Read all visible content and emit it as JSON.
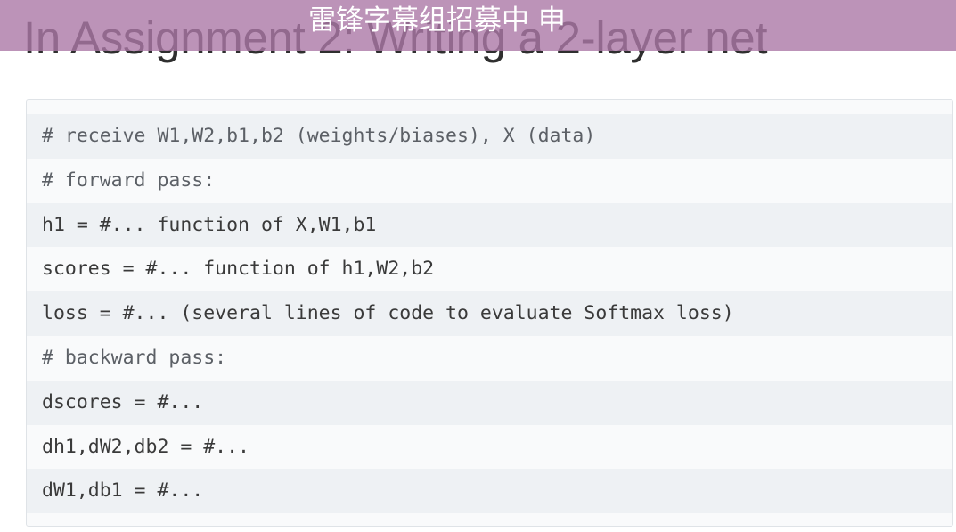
{
  "slide": {
    "title": "In Assignment 2: Writing a 2-layer net"
  },
  "subtitle_banner": {
    "text": "雷锋字幕组招募中 申",
    "color": "#ab78a6"
  },
  "code": {
    "lines": [
      "# receive W1,W2,b1,b2 (weights/biases), X (data)",
      "# forward pass:",
      "h1 = #... function of X,W1,b1",
      "scores = #... function of h1,W2,b2",
      "loss = #... (several lines of code to evaluate Softmax loss)",
      "# backward pass:",
      "dscores = #...",
      "dh1,dW2,db2 = #...",
      "dW1,db1 = #..."
    ]
  }
}
